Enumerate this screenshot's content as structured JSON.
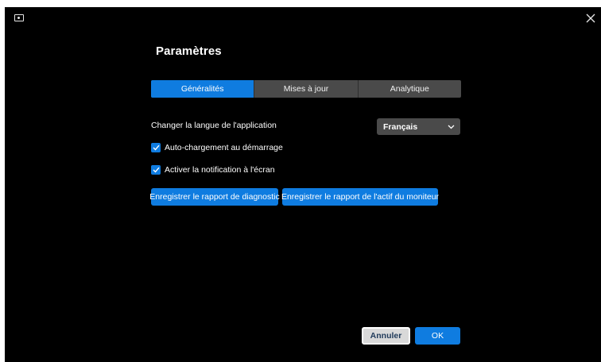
{
  "window": {
    "app_icon": "monitor-icon",
    "close_icon": "close-icon"
  },
  "page": {
    "title": "Paramètres"
  },
  "tabs": [
    {
      "label": "Généralités",
      "active": true
    },
    {
      "label": "Mises à jour",
      "active": false
    },
    {
      "label": "Analytique",
      "active": false
    }
  ],
  "general": {
    "language_label": "Changer la langue de l'application",
    "language_value": "Français",
    "autoload_label": "Auto-chargement au démarrage",
    "autoload_checked": true,
    "notification_label": "Activer la notification à l'écran",
    "notification_checked": true,
    "diagnostic_button": "Enregistrer le rapport de diagnostic",
    "asset_report_button": "Enregistrer le rapport de l'actif du moniteur"
  },
  "footer": {
    "cancel_label": "Annuler",
    "ok_label": "OK"
  },
  "colors": {
    "accent": "#0f7ce0",
    "background": "#000000",
    "control_bg": "#4a4a4a"
  }
}
